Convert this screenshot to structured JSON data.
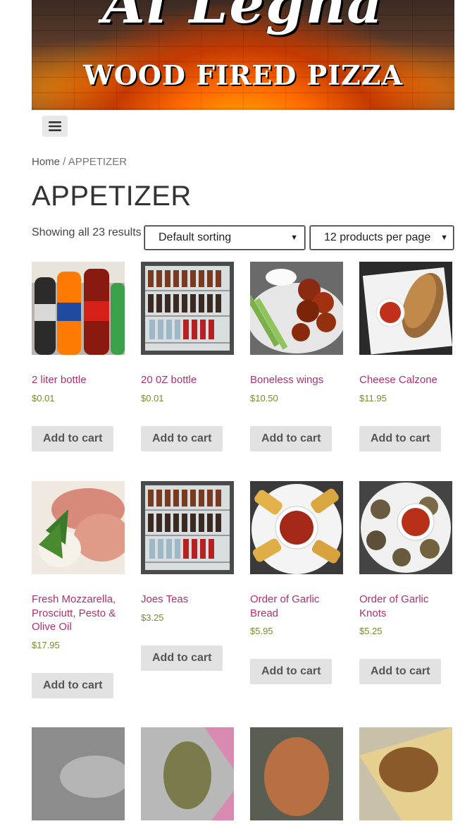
{
  "banner": {
    "script_text": "Al Legna",
    "subtitle": "WOOD FIRED PIZZA"
  },
  "menu": {
    "icon": "hamburger-menu-icon"
  },
  "breadcrumb": {
    "home": "Home",
    "separator": " / ",
    "current": "APPETIZER"
  },
  "page_title": "APPETIZER",
  "result_count": "Showing all 23 results",
  "sorting": {
    "selected": "Default sorting"
  },
  "per_page": {
    "selected": "12 products per page"
  },
  "colors": {
    "product_link": "#b0306e",
    "price": "#7b8a2e",
    "button_bg": "#e2e2e2"
  },
  "products": [
    {
      "name": "2 liter bottle",
      "price": "$0.01",
      "cart": "Add to cart",
      "image": "soda-bottles"
    },
    {
      "name": "20 0Z bottle",
      "price": "$0.01",
      "cart": "Add to cart",
      "image": "drink-cooler"
    },
    {
      "name": "Boneless wings",
      "price": "$10.50",
      "cart": "Add to cart",
      "image": "wings"
    },
    {
      "name": "Cheese Calzone",
      "price": "$11.95",
      "cart": "Add to cart",
      "image": "calzone"
    },
    {
      "name": "Fresh Mozzarella, Prosciutt, Pesto & Olive Oil",
      "price": "$17.95",
      "cart": "Add to cart",
      "image": "prosciutto"
    },
    {
      "name": "Joes Teas",
      "price": "$3.25",
      "cart": "Add to cart",
      "image": "drink-cooler"
    },
    {
      "name": "Order of Garlic Bread",
      "price": "$5.95",
      "cart": "Add to cart",
      "image": "garlic-bread"
    },
    {
      "name": "Order of Garlic Knots",
      "price": "$5.25",
      "cart": "Add to cart",
      "image": "garlic-knots"
    },
    {
      "name": "",
      "price": "",
      "cart": "",
      "image": "blurred-gray"
    },
    {
      "name": "",
      "price": "",
      "cart": "",
      "image": "blurred-pink"
    },
    {
      "name": "",
      "price": "",
      "cart": "",
      "image": "blurred-orange"
    },
    {
      "name": "",
      "price": "",
      "cart": "",
      "image": "blurred-tan"
    }
  ]
}
